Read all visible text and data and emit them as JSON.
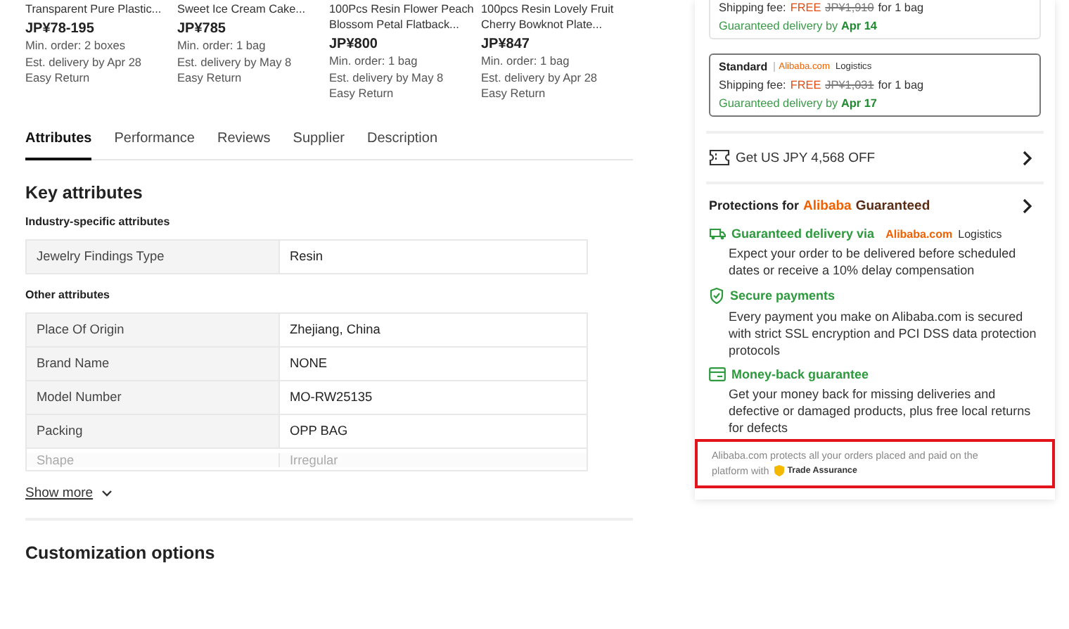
{
  "products": [
    {
      "title": "Transparent Pure Plastic...",
      "price": "JP¥78-195",
      "min_order": "Min. order: 2 boxes",
      "delivery": "Est. delivery by Apr 28",
      "returns": "Easy Return"
    },
    {
      "title": "Sweet Ice Cream Cake...",
      "price": "JP¥785",
      "min_order": "Min. order: 1 bag",
      "delivery": "Est. delivery by May 8",
      "returns": "Easy Return"
    },
    {
      "title": "100Pcs Resin Flower Peach Blossom Petal Flatback...",
      "price": "JP¥800",
      "min_order": "Min. order: 1 bag",
      "delivery": "Est. delivery by May 8",
      "returns": "Easy Return"
    },
    {
      "title": "100pcs Resin Lovely Fruit Cherry Bowknot Plate...",
      "price": "JP¥847",
      "min_order": "Min. order: 1 bag",
      "delivery": "Est. delivery by Apr 28",
      "returns": "Easy Return"
    }
  ],
  "tabs": [
    {
      "label": "Attributes",
      "selected": true
    },
    {
      "label": "Performance",
      "selected": false
    },
    {
      "label": "Reviews",
      "selected": false
    },
    {
      "label": "Supplier",
      "selected": false
    },
    {
      "label": "Description",
      "selected": false
    }
  ],
  "key_attributes": {
    "title": "Key attributes",
    "groups": [
      {
        "title": "Industry-specific attributes",
        "rows": [
          {
            "name": "Jewelry Findings Type",
            "value": "Resin",
            "faded": false
          }
        ]
      },
      {
        "title": "Other attributes",
        "rows": [
          {
            "name": "Place Of Origin",
            "value": "Zhejiang, China",
            "faded": false
          },
          {
            "name": "Brand Name",
            "value": "NONE",
            "faded": false
          },
          {
            "name": "Model Number",
            "value": "MO-RW25135",
            "faded": false
          },
          {
            "name": "Packing",
            "value": "OPP BAG",
            "faded": false
          },
          {
            "name": "Shape",
            "value": "Irregular",
            "faded": true
          }
        ]
      }
    ],
    "show_more": "Show more"
  },
  "customization": {
    "title": "Customization options"
  },
  "shipping_options": [
    {
      "fee_label": "Shipping fee:",
      "free": "FREE",
      "old_price": "JP¥1,910",
      "unit": "for 1 bag",
      "delivery": "Guaranteed delivery by **Apr 14**",
      "selected": false
    },
    {
      "name": "Standard",
      "carrier_brand": "Alibaba.com",
      "carrier": "Logistics",
      "fee_label": "Shipping fee:",
      "free": "FREE",
      "old_price": "JP¥1,031",
      "unit": "for 1 bag",
      "delivery": "Guaranteed delivery by **Apr 17**",
      "selected": true
    }
  ],
  "coupon": {
    "label": "Get US JPY 4,568 OFF"
  },
  "protections": {
    "title": "Protections for",
    "brand": "Alibaba",
    "brand_suffix": "Guaranteed",
    "items": [
      {
        "kind": "truck",
        "title": "Guaranteed delivery via",
        "brand": "Alibaba.com",
        "brand_suffix": "Logistics",
        "text": "Expect your order to be delivered before scheduled dates or receive a 10% delay compensation"
      },
      {
        "kind": "shield",
        "title": "Secure payments",
        "text": "Every payment you make on Alibaba.com is secured with strict SSL encryption and PCI DSS data protection protocols"
      },
      {
        "kind": "card",
        "title": "Money-back guarantee",
        "text": "Get your money back for missing deliveries and defective or damaged products, plus free local returns for defects"
      }
    ],
    "footer_lines": [
      "Alibaba.com protects all your orders placed and paid on the",
      "platform with"
    ],
    "badge": "Trade Assurance",
    "highlighted": true
  }
}
